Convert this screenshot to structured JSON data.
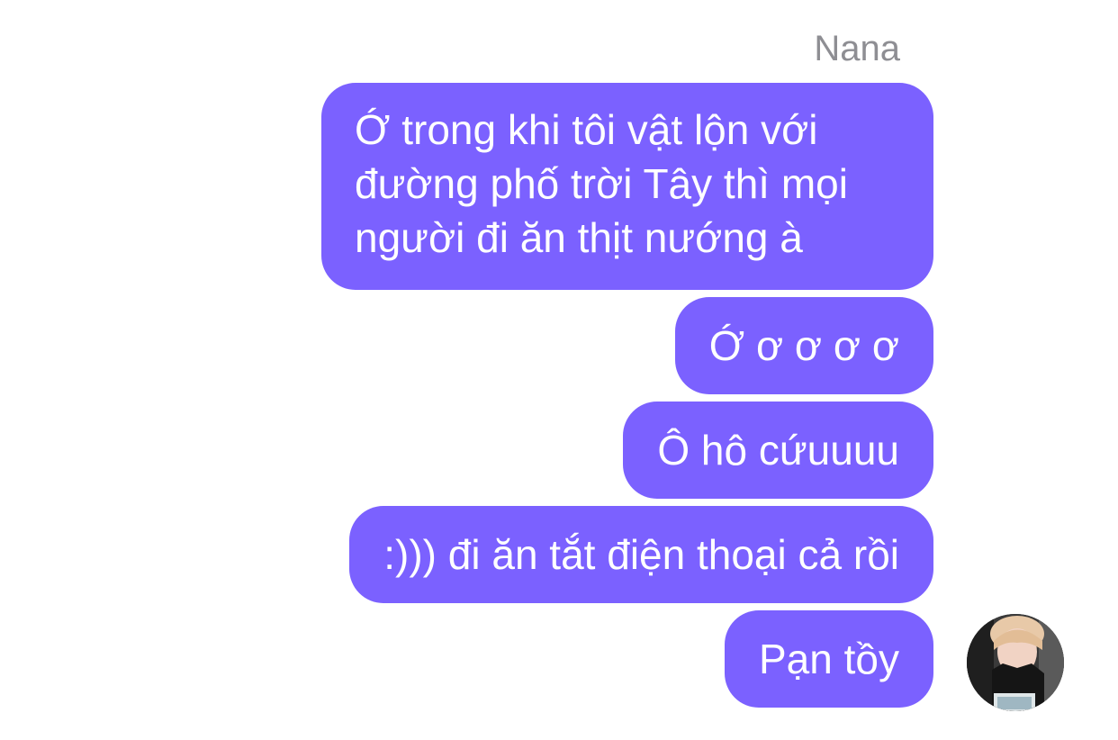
{
  "conversation": {
    "sender_name": "Nana",
    "accent_color": "#7b61ff",
    "messages": [
      {
        "text": "Ớ trong khi tôi vật lộn với\nđường phố trời Tây thì mọi\nngười đi ăn thịt nướng à"
      },
      {
        "text": "Ớ ơ ơ ơ ơ"
      },
      {
        "text": "Ô hô cứuuuu"
      },
      {
        "text": ":))) đi ăn tắt điện thoại cả rồi"
      },
      {
        "text": "Pạn tồy"
      }
    ],
    "avatar": {
      "icon": "user-avatar-photo"
    }
  }
}
